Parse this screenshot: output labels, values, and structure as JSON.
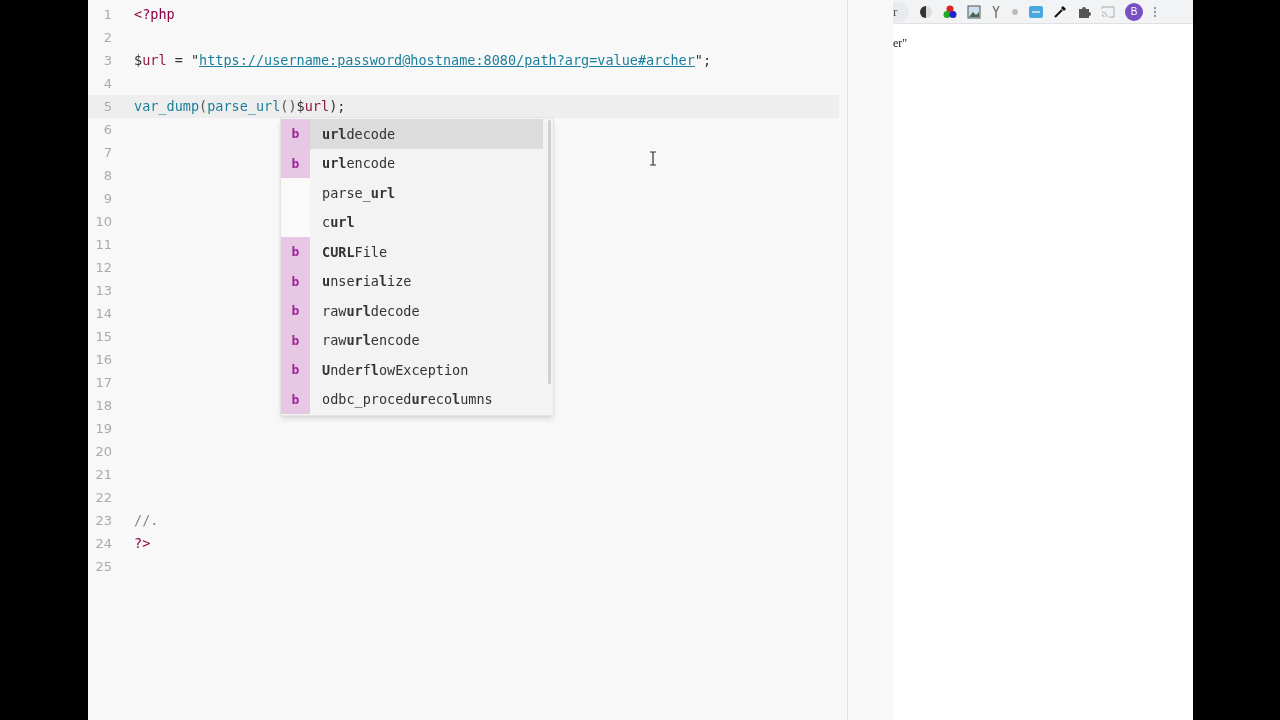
{
  "editor": {
    "lines": [
      {
        "number": "1",
        "active": false,
        "tokens": [
          {
            "text": "<?php",
            "kind": "tag"
          }
        ]
      },
      {
        "number": "2",
        "active": false
      },
      {
        "number": "3",
        "active": false,
        "tokens": [
          {
            "text": "$",
            "kind": "plain"
          },
          {
            "text": "url",
            "kind": "var"
          },
          {
            "text": " = \"",
            "kind": "plain"
          },
          {
            "text": "https://username:password@hostname:8080/path?arg=value#archer",
            "kind": "link"
          },
          {
            "text": "\";",
            "kind": "plain"
          }
        ]
      },
      {
        "number": "4",
        "active": false
      },
      {
        "number": "5",
        "active": true,
        "tokens": [
          {
            "text": "var_dump",
            "kind": "func"
          },
          {
            "text": "(",
            "kind": "punct"
          },
          {
            "text": "parse_url",
            "kind": "func"
          },
          {
            "text": "()",
            "kind": "punct"
          },
          {
            "text": "$",
            "kind": "plain"
          },
          {
            "text": "url",
            "kind": "var"
          },
          {
            "text": ");",
            "kind": "plain"
          }
        ]
      },
      {
        "number": "6",
        "active": false
      },
      {
        "number": "7",
        "active": false
      },
      {
        "number": "8",
        "active": false
      },
      {
        "number": "9",
        "active": false
      },
      {
        "number": "10",
        "active": false
      },
      {
        "number": "11",
        "active": false
      },
      {
        "number": "12",
        "active": false
      },
      {
        "number": "13",
        "active": false
      },
      {
        "number": "14",
        "active": false
      },
      {
        "number": "15",
        "active": false
      },
      {
        "number": "16",
        "active": false
      },
      {
        "number": "17",
        "active": false
      },
      {
        "number": "18",
        "active": false
      },
      {
        "number": "19",
        "active": false
      },
      {
        "number": "20",
        "active": false
      },
      {
        "number": "21",
        "active": false
      },
      {
        "number": "22",
        "active": false
      },
      {
        "number": "23",
        "active": false,
        "tokens": [
          {
            "text": "//.",
            "kind": "comment"
          }
        ]
      },
      {
        "number": "24",
        "active": false,
        "tokens": [
          {
            "text": "?>",
            "kind": "tag"
          }
        ]
      },
      {
        "number": "25",
        "active": false
      }
    ]
  },
  "autocomplete": {
    "items": [
      {
        "label": "**url**decode",
        "badge": "b",
        "selected": true
      },
      {
        "label": "**url**encode",
        "badge": "b",
        "selected": false
      },
      {
        "label": "parse_**url**",
        "selected": false
      },
      {
        "label": "c**url**",
        "selected": false
      },
      {
        "label": "**CURL**File",
        "badge": "b",
        "selected": false
      },
      {
        "label": "**u**nse**r**ia**l**ize",
        "badge": "b",
        "selected": false
      },
      {
        "label": "raw**url**decode",
        "badge": "b",
        "selected": false
      },
      {
        "label": "raw**url**encode",
        "badge": "b",
        "selected": false
      },
      {
        "label": "**U**nde**r**f**l**owException",
        "badge": "b",
        "selected": false
      },
      {
        "label": "odbc_proced**ur**eco**l**umns",
        "badge": "b",
        "selected": false
      }
    ]
  },
  "browser": {
    "address_fragment": "r",
    "avatar": "B",
    "page_text": "er\""
  }
}
